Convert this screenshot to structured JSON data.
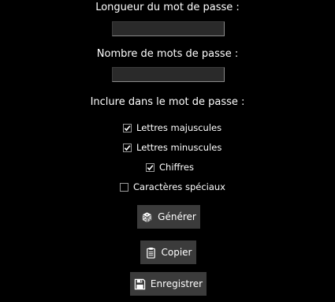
{
  "form": {
    "length_label": "Longueur du mot de passe :",
    "length_value": "",
    "count_label": "Nombre de mots de passe :",
    "count_value": "",
    "include_label": "Inclure dans le mot de passe :"
  },
  "options": [
    {
      "label": "Lettres majuscules",
      "checked": true
    },
    {
      "label": "Lettres minuscules",
      "checked": true
    },
    {
      "label": "Chiffres",
      "checked": true
    },
    {
      "label": "Caractères spéciaux",
      "checked": false
    }
  ],
  "buttons": {
    "generate_label": "Générer",
    "generate_icon": "dice-icon",
    "copy_label": "Copier",
    "copy_icon": "clipboard-icon",
    "save_label": "Enregistrer",
    "save_icon": "floppy-disk-icon"
  },
  "colors": {
    "background": "#000000",
    "text": "#ffffff",
    "button": "#3b3b3b",
    "field": "#2a2a2a"
  }
}
